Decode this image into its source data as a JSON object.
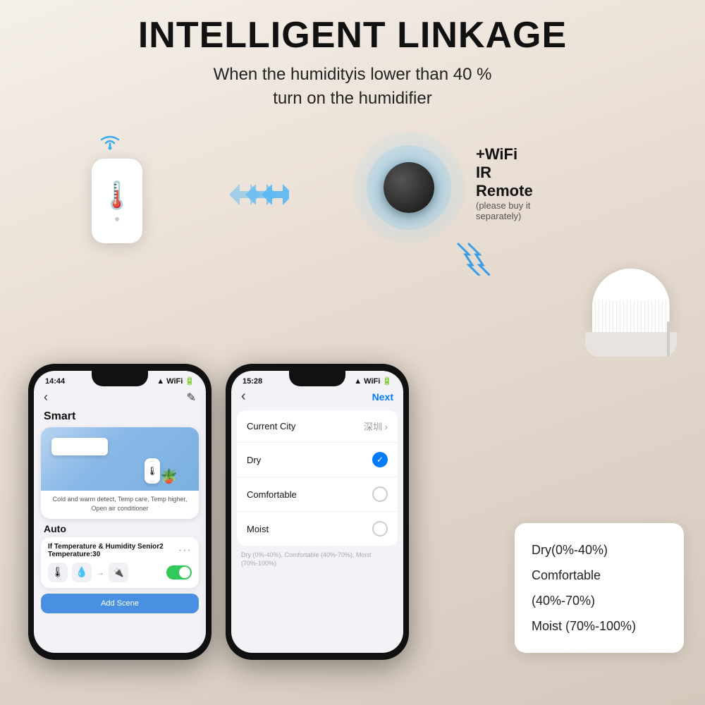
{
  "page": {
    "background": "#e8ddd2"
  },
  "header": {
    "title": "INTELLIGENT LINKAGE",
    "subtitle_line1": "When the humidityis lower than 40 %",
    "subtitle_line2": "turn on the humidifier"
  },
  "ir_remote": {
    "label": "+WiFi IR Remote",
    "sublabel": "(please buy it separately)"
  },
  "phone1": {
    "status_time": "14:44",
    "nav_back": "‹",
    "nav_edit": "✎",
    "section_smart": "Smart",
    "card_desc": "Cold and warm detect, Temp care, Temp higher,\nOpen air conditioner",
    "section_auto": "Auto",
    "automation_title": "If Temperature & Humidity Senior2\nTemperature:30",
    "add_scene": "Add Scene"
  },
  "phone2": {
    "status_time": "15:28",
    "nav_back": "‹",
    "nav_next": "Next",
    "current_city_label": "Current City",
    "current_city_value": "深圳 ›",
    "dry_label": "Dry",
    "comfortable_label": "Comfortable",
    "moist_label": "Moist",
    "hint": "Dry (0%-40%), Comfortable (40%-70%), Moist (70%-100%)"
  },
  "info_panel": {
    "dry": "Dry(0%-40%)",
    "comfortable": "Comfortable (40%-70%)",
    "moist": "Moist (70%-100%)"
  }
}
